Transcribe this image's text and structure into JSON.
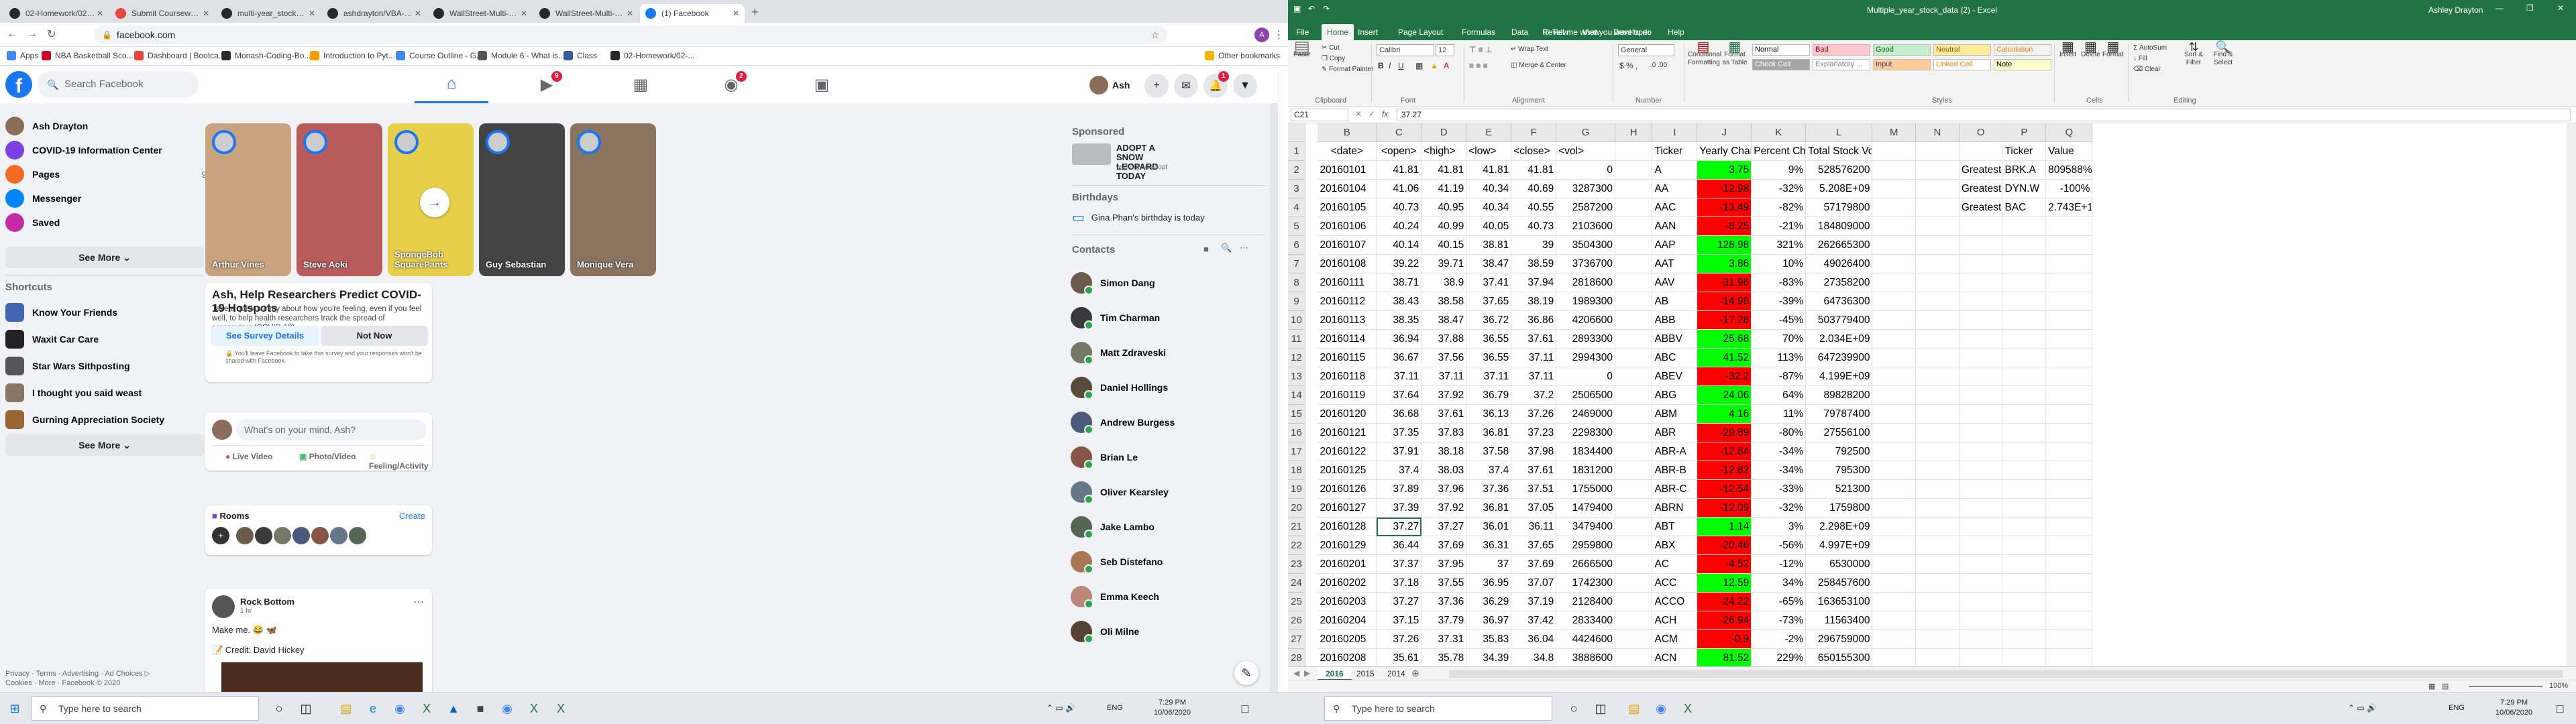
{
  "browser": {
    "tabs": [
      {
        "title": "02-Homework/02-VBA-Scriptin",
        "fav": "#24292e"
      },
      {
        "title": "Submit Coursework | Bootcam",
        "fav": "#e8453c"
      },
      {
        "title": "multi-year_stock_data/Multi-Yr",
        "fav": "#24292e"
      },
      {
        "title": "ashdrayton/VBA-challenge",
        "fav": "#24292e"
      },
      {
        "title": "WallStreet-Multi-Year-Data-VBA",
        "fav": "#24292e"
      },
      {
        "title": "WallStreet-Multi-Year-Data-VBA",
        "fav": "#24292e"
      },
      {
        "title": "(1) Facebook",
        "fav": "#1877f2"
      }
    ],
    "url": "facebook.com",
    "bookmarks": [
      {
        "label": "Apps",
        "color": "#4285f4"
      },
      {
        "label": "NBA Basketball Sco...",
        "color": "#c9082a"
      },
      {
        "label": "Dashboard | Bootca...",
        "color": "#e8453c"
      },
      {
        "label": "Monash-Coding-Bo...",
        "color": "#24292e"
      },
      {
        "label": "Introduction to Pyt...",
        "color": "#ff9900"
      },
      {
        "label": "Course Outline - G...",
        "color": "#4285f4"
      },
      {
        "label": "Module 6 - What is...",
        "color": "#555555"
      },
      {
        "label": "Class",
        "color": "#3b5998"
      },
      {
        "label": "02-Homework/02-...",
        "color": "#24292e"
      }
    ],
    "other_bookmarks": "Other bookmarks"
  },
  "facebook": {
    "search_placeholder": "Search Facebook",
    "user_short": "Ash",
    "nav_badges": {
      "watch": "9",
      "groups": "2",
      "notifications": "1"
    },
    "left_nav": [
      {
        "label": "Ash Drayton",
        "color": "#8a6d5a",
        "count": ""
      },
      {
        "label": "COVID-19 Information Center",
        "color": "#7b3fe4",
        "count": ""
      },
      {
        "label": "Pages",
        "color": "#f26b21",
        "count": "9"
      },
      {
        "label": "Messenger",
        "color": "#0084ff",
        "count": ""
      },
      {
        "label": "Saved",
        "color": "#c32aa3",
        "count": ""
      }
    ],
    "see_more": "See More",
    "shortcuts_title": "Shortcuts",
    "shortcuts": [
      {
        "label": "Know Your Friends",
        "color": "#4267b2"
      },
      {
        "label": "Waxit Car Care",
        "color": "#222222"
      },
      {
        "label": "Star Wars Sithposting",
        "color": "#555555"
      },
      {
        "label": "I thought you said weast",
        "color": "#887766"
      },
      {
        "label": "Gurning Appreciation Society",
        "color": "#996633"
      }
    ],
    "footer": [
      "Privacy · Terms · Advertising · Ad Choices ▷",
      "Cookies · More · Facebook © 2020"
    ],
    "stories": [
      {
        "name": "Arthur Vines",
        "color": "#c9a27e"
      },
      {
        "name": "Steve Aoki",
        "color": "#b85b5b"
      },
      {
        "name": "SpongeBob SquarePants",
        "color": "#e8cf4a"
      },
      {
        "name": "Guy Sebastian",
        "color": "#444444"
      },
      {
        "name": "Monique Vera",
        "color": "#8a7460"
      }
    ],
    "survey": {
      "title": "Ash, Help Researchers Predict COVID-19 Hotspots",
      "body": "Take a quick survey about how you're feeling, even if you feel well, to help health researchers track the spread of coronavirus (COVID-19).",
      "primary": "See Survey Details",
      "secondary": "Not Now",
      "note": "You'll leave Facebook to take this survey and your responses won't be shared with Facebook."
    },
    "composer": {
      "placeholder": "What's on your mind, Ash?",
      "live": "Live Video",
      "photo": "Photo/Video",
      "feeling": "Feeling/Activity"
    },
    "rooms": {
      "title": "Rooms",
      "create": "Create"
    },
    "post": {
      "author": "Rock Bottom",
      "time": "1 hr",
      "text": "Make me. 😂 🦋",
      "credit": "📝 Credit: David Hickey"
    },
    "sponsored": {
      "title": "Sponsored",
      "ad_title": "ADOPT A SNOW LEOPARD TODAY",
      "ad_url": "wwf.org.au/adopt"
    },
    "birthdays": {
      "title": "Birthdays",
      "text": "Gina Phan's birthday is today"
    },
    "contacts_title": "Contacts",
    "contacts": [
      {
        "name": "Simon Dang",
        "color": "#6b5b4b"
      },
      {
        "name": "Tim Charman",
        "color": "#3a3a3a"
      },
      {
        "name": "Matt Zdraveski",
        "color": "#777766"
      },
      {
        "name": "Daniel Hollings",
        "color": "#5a4a3a"
      },
      {
        "name": "Andrew Burgess",
        "color": "#4a5a7a"
      },
      {
        "name": "Brian Le",
        "color": "#885544"
      },
      {
        "name": "Oliver Kearsley",
        "color": "#667788"
      },
      {
        "name": "Jake Lambo",
        "color": "#556655"
      },
      {
        "name": "Seb Distefano",
        "color": "#aa7755"
      },
      {
        "name": "Emma Keech",
        "color": "#bb8877"
      },
      {
        "name": "Oli Milne",
        "color": "#554433"
      }
    ]
  },
  "excel": {
    "title": "Multiple_year_stock_data (2)  -  Excel",
    "user": "Ashley Drayton",
    "tabs": [
      "File",
      "Home",
      "Insert",
      "Page Layout",
      "Formulas",
      "Data",
      "Review",
      "View",
      "Developer",
      "Help"
    ],
    "tell_me": "Tell me what you want to do",
    "ribbon": {
      "paste": "Paste",
      "cut": "Cut",
      "copy": "Copy",
      "format_painter": "Format Painter",
      "font": "Calibri",
      "font_size": "12",
      "wrap": "Wrap Text",
      "merge": "Merge & Center",
      "number_format": "General",
      "cond": "Conditional Formatting",
      "format_table": "Format as Table",
      "insert": "Insert",
      "delete": "Delete",
      "format": "Format",
      "autosum": "AutoSum",
      "fill": "Fill",
      "clear": "Clear",
      "sort": "Sort & Filter",
      "find": "Find & Select",
      "groups": [
        "Clipboard",
        "Font",
        "Alignment",
        "Number",
        "Styles",
        "Cells",
        "Editing"
      ],
      "styles": [
        {
          "label": "Normal",
          "bg": "#ffffff",
          "fg": "#000000"
        },
        {
          "label": "Bad",
          "bg": "#ffc7ce",
          "fg": "#9c0006"
        },
        {
          "label": "Good",
          "bg": "#c6efce",
          "fg": "#006100"
        },
        {
          "label": "Neutral",
          "bg": "#ffeb9c",
          "fg": "#9c5700"
        },
        {
          "label": "Calculation",
          "bg": "#f2f2f2",
          "fg": "#fa7d00"
        },
        {
          "label": "Check Cell",
          "bg": "#a5a5a5",
          "fg": "#ffffff"
        },
        {
          "label": "Explanatory ...",
          "bg": "#ffffff",
          "fg": "#7f7f7f"
        },
        {
          "label": "Input",
          "bg": "#ffcc99",
          "fg": "#3f3f76"
        },
        {
          "label": "Linked Cell",
          "bg": "#ffffff",
          "fg": "#fa7d00"
        },
        {
          "label": "Note",
          "bg": "#ffffcc",
          "fg": "#000000"
        }
      ]
    },
    "name_box": "C21",
    "formula": "37.27",
    "columns": [
      "B",
      "C",
      "D",
      "E",
      "F",
      "G",
      "H",
      "I",
      "J",
      "K",
      "L",
      "M",
      "N",
      "O",
      "P",
      "Q"
    ],
    "header_row": [
      "<date>",
      "<open>",
      "<high>",
      "<low>",
      "<close>",
      "<vol>",
      "",
      "Ticker",
      "Yearly Change",
      "Percent Change",
      "Total Stock Volume",
      "",
      "",
      "",
      "Ticker",
      "Value"
    ],
    "rows": [
      {
        "n": "2",
        "d": [
          "20160101",
          "41.81",
          "41.81",
          "41.81",
          "41.81",
          "0",
          "",
          "A",
          "3.75",
          "9%",
          "528576200"
        ],
        "pos": true
      },
      {
        "n": "3",
        "d": [
          "20160104",
          "41.06",
          "41.19",
          "40.34",
          "40.69",
          "3287300",
          "",
          "AA",
          "-12.98",
          "-32%",
          "5.208E+09"
        ],
        "pos": false
      },
      {
        "n": "4",
        "d": [
          "20160105",
          "40.73",
          "40.95",
          "40.34",
          "40.55",
          "2587200",
          "",
          "AAC",
          "-13.49",
          "-82%",
          "57179800"
        ],
        "pos": false
      },
      {
        "n": "5",
        "d": [
          "20160106",
          "40.24",
          "40.99",
          "40.05",
          "40.73",
          "2103600",
          "",
          "AAN",
          "-8.25",
          "-21%",
          "184809000"
        ],
        "pos": false
      },
      {
        "n": "6",
        "d": [
          "20160107",
          "40.14",
          "40.15",
          "38.81",
          "39",
          "3504300",
          "",
          "AAP",
          "128.98",
          "321%",
          "262665300"
        ],
        "pos": true
      },
      {
        "n": "7",
        "d": [
          "20160108",
          "39.22",
          "39.71",
          "38.47",
          "38.59",
          "3736700",
          "",
          "AAT",
          "3.86",
          "10%",
          "49026400"
        ],
        "pos": true
      },
      {
        "n": "8",
        "d": [
          "20160111",
          "38.71",
          "38.9",
          "37.41",
          "37.94",
          "2818600",
          "",
          "AAV",
          "-31.96",
          "-83%",
          "27358200"
        ],
        "pos": false
      },
      {
        "n": "9",
        "d": [
          "20160112",
          "38.43",
          "38.58",
          "37.65",
          "38.19",
          "1989300",
          "",
          "AB",
          "-14.98",
          "-39%",
          "64736300"
        ],
        "pos": false
      },
      {
        "n": "10",
        "d": [
          "20160113",
          "38.35",
          "38.47",
          "36.72",
          "36.86",
          "4206600",
          "",
          "ABB",
          "-17.28",
          "-45%",
          "503779400"
        ],
        "pos": false
      },
      {
        "n": "11",
        "d": [
          "20160114",
          "36.94",
          "37.88",
          "36.55",
          "37.61",
          "2893300",
          "",
          "ABBV",
          "25.68",
          "70%",
          "2.034E+09"
        ],
        "pos": true
      },
      {
        "n": "12",
        "d": [
          "20160115",
          "36.67",
          "37.56",
          "36.55",
          "37.11",
          "2994300",
          "",
          "ABC",
          "41.52",
          "113%",
          "647239900"
        ],
        "pos": true
      },
      {
        "n": "13",
        "d": [
          "20160118",
          "37.11",
          "37.11",
          "37.11",
          "37.11",
          "0",
          "",
          "ABEV",
          "-32.2",
          "-87%",
          "4.199E+09"
        ],
        "pos": false
      },
      {
        "n": "14",
        "d": [
          "20160119",
          "37.64",
          "37.92",
          "36.79",
          "37.2",
          "2506500",
          "",
          "ABG",
          "24.06",
          "64%",
          "89828200"
        ],
        "pos": true
      },
      {
        "n": "15",
        "d": [
          "20160120",
          "36.68",
          "37.61",
          "36.13",
          "37.26",
          "2469000",
          "",
          "ABM",
          "4.16",
          "11%",
          "79787400"
        ],
        "pos": true
      },
      {
        "n": "16",
        "d": [
          "20160121",
          "37.35",
          "37.83",
          "36.81",
          "37.23",
          "2298300",
          "",
          "ABR",
          "-29.89",
          "-80%",
          "27556100"
        ],
        "pos": false
      },
      {
        "n": "17",
        "d": [
          "20160122",
          "37.91",
          "38.18",
          "37.58",
          "37.98",
          "1834400",
          "",
          "ABR-A",
          "-12.84",
          "-34%",
          "792500"
        ],
        "pos": false
      },
      {
        "n": "18",
        "d": [
          "20160125",
          "37.4",
          "38.03",
          "37.4",
          "37.61",
          "1831200",
          "",
          "ABR-B",
          "-12.82",
          "-34%",
          "795300"
        ],
        "pos": false
      },
      {
        "n": "19",
        "d": [
          "20160126",
          "37.89",
          "37.96",
          "37.36",
          "37.51",
          "1755000",
          "",
          "ABR-C",
          "-12.54",
          "-33%",
          "521300"
        ],
        "pos": false
      },
      {
        "n": "20",
        "d": [
          "20160127",
          "37.39",
          "37.92",
          "36.81",
          "37.05",
          "1479400",
          "",
          "ABRN",
          "-12.09",
          "-32%",
          "1759800"
        ],
        "pos": false
      },
      {
        "n": "21",
        "d": [
          "20160128",
          "37.27",
          "37.27",
          "36.01",
          "36.11",
          "3479400",
          "",
          "ABT",
          "1.14",
          "3%",
          "2.298E+09"
        ],
        "pos": true
      },
      {
        "n": "22",
        "d": [
          "20160129",
          "36.44",
          "37.69",
          "36.31",
          "37.65",
          "2959800",
          "",
          "ABX",
          "-20.46",
          "-56%",
          "4.997E+09"
        ],
        "pos": false
      },
      {
        "n": "23",
        "d": [
          "20160201",
          "37.37",
          "37.95",
          "37",
          "37.69",
          "2666500",
          "",
          "AC",
          "-4.52",
          "-12%",
          "6530000"
        ],
        "pos": false
      },
      {
        "n": "24",
        "d": [
          "20160202",
          "37.18",
          "37.55",
          "36.95",
          "37.07",
          "1742300",
          "",
          "ACC",
          "12.59",
          "34%",
          "258457600"
        ],
        "pos": true
      },
      {
        "n": "25",
        "d": [
          "20160203",
          "37.27",
          "37.36",
          "36.29",
          "37.19",
          "2128400",
          "",
          "ACCO",
          "-24.22",
          "-65%",
          "163653100"
        ],
        "pos": false
      },
      {
        "n": "26",
        "d": [
          "20160204",
          "37.15",
          "37.79",
          "36.97",
          "37.42",
          "2833400",
          "",
          "ACH",
          "-26.94",
          "-73%",
          "11563400"
        ],
        "pos": false
      },
      {
        "n": "27",
        "d": [
          "20160205",
          "37.26",
          "37.31",
          "35.83",
          "36.04",
          "4424600",
          "",
          "ACM",
          "-0.9",
          "-2%",
          "296759000"
        ],
        "pos": false
      },
      {
        "n": "28",
        "d": [
          "20160208",
          "35.61",
          "35.78",
          "34.39",
          "34.8",
          "3888600",
          "",
          "ACN",
          "81.52",
          "229%",
          "650155300"
        ],
        "pos": true
      }
    ],
    "summary": [
      {
        "label": "Greatest % Increase",
        "ticker": "BRK.A",
        "value": "809588%"
      },
      {
        "label": "Greatest % Decrease",
        "ticker": "DYN.W",
        "value": "-100%"
      },
      {
        "label": "Greatest Total Volume",
        "ticker": "BAC",
        "value": "2.743E+10"
      }
    ],
    "sheet_tabs": [
      "2016",
      "2015",
      "2014"
    ],
    "zoom": "100%",
    "colors": {
      "positive": "#00ff00",
      "negative": "#ff0000",
      "accent": "#217346"
    }
  },
  "taskbar": {
    "search_placeholder": "Type here to search",
    "time": "7:29 PM",
    "date": "10/06/2020",
    "lang": "ENG"
  }
}
